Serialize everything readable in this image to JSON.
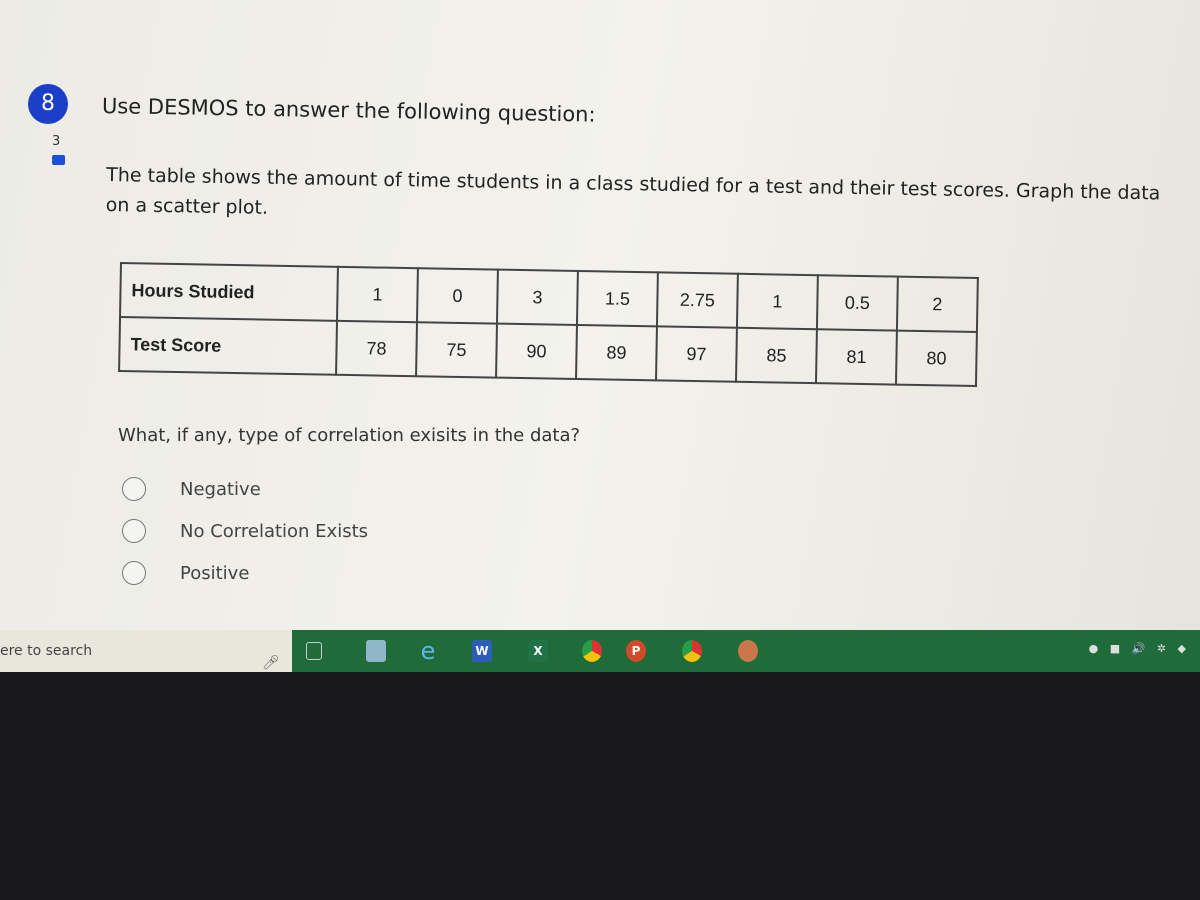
{
  "question": {
    "number": "8",
    "points": "3",
    "prompt": "Use DESMOS to answer the following question:",
    "description": "The table shows the amount of time students in a class studied for a test and their test scores. Graph the data on a scatter plot.",
    "table": {
      "rows": [
        {
          "label": "Hours Studied",
          "values": [
            "1",
            "0",
            "3",
            "1.5",
            "2.75",
            "1",
            "0.5",
            "2"
          ]
        },
        {
          "label": "Test Score",
          "values": [
            "78",
            "75",
            "90",
            "89",
            "97",
            "85",
            "81",
            "80"
          ]
        }
      ]
    },
    "ask": "What, if any, type of correlation exisits in the data?",
    "options": [
      "Negative",
      "No Correlation Exists",
      "Positive"
    ],
    "accent_color": "#1c3fc9"
  },
  "taskbar": {
    "search_text": "ere to search",
    "apps": [
      "task-view",
      "file-explorer",
      "internet-explorer",
      "word",
      "excel",
      "chrome",
      "powerpoint",
      "chrome",
      "app"
    ],
    "color": "#1f6b3a"
  }
}
